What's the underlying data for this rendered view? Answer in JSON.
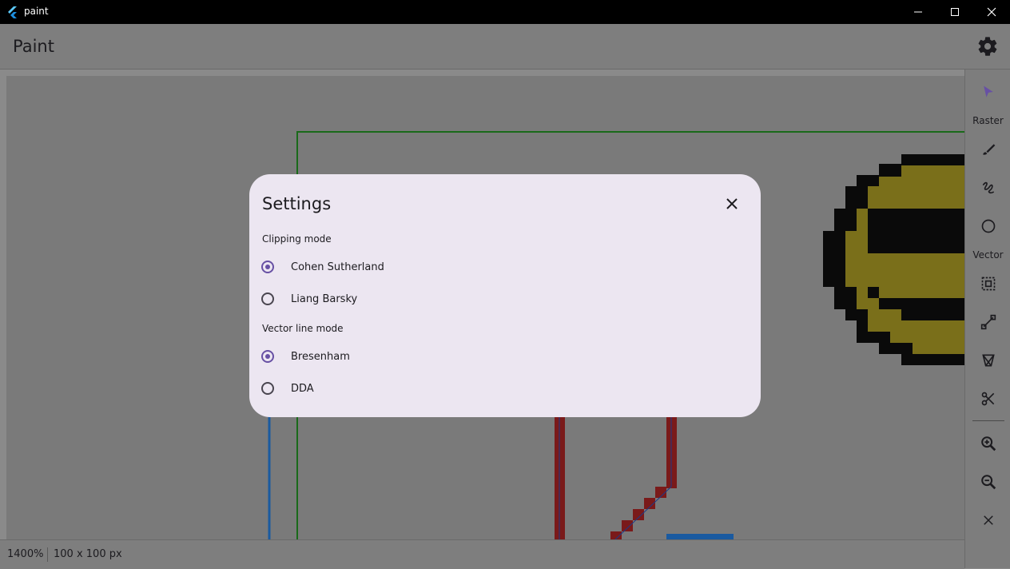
{
  "window": {
    "title": "paint",
    "buttons": [
      "minimize",
      "maximize",
      "close"
    ]
  },
  "appbar": {
    "title": "Paint",
    "settings_icon": "gear-icon"
  },
  "sidebar": {
    "sections": [
      {
        "label": "Raster"
      },
      {
        "label": "Vector"
      }
    ],
    "tools": [
      {
        "name": "select",
        "icon": "cursor-icon",
        "selected": true
      },
      {
        "name": "brush",
        "icon": "brush-icon"
      },
      {
        "name": "freehand",
        "icon": "squiggle-icon"
      },
      {
        "name": "circle",
        "icon": "circle-icon"
      },
      {
        "name": "rect-select",
        "icon": "selection-icon"
      },
      {
        "name": "line",
        "icon": "line-icon"
      },
      {
        "name": "polygon",
        "icon": "polygon-icon"
      },
      {
        "name": "clip",
        "icon": "scissors-icon"
      },
      {
        "name": "zoom-in",
        "icon": "zoom-in-icon"
      },
      {
        "name": "zoom-out",
        "icon": "zoom-out-icon"
      },
      {
        "name": "clear",
        "icon": "close-icon"
      }
    ]
  },
  "status": {
    "zoom": "1400%",
    "size": "100 x 100 px"
  },
  "dialog": {
    "title": "Settings",
    "clipping": {
      "label": "Clipping mode",
      "options": [
        "Cohen Sutherland",
        "Liang Barsky"
      ],
      "selected": "Cohen Sutherland"
    },
    "line": {
      "label": "Vector line mode",
      "options": [
        "Bresenham",
        "DDA"
      ],
      "selected": "Bresenham"
    }
  },
  "colors": {
    "accent": "#6750a4",
    "dialog_bg": "#ece6f1",
    "smiley_fill": "#7a6f1a",
    "red_pixels": "#7a1a1a",
    "blue_line": "#1a5aa0",
    "green_rect": "#1a6a1a"
  }
}
